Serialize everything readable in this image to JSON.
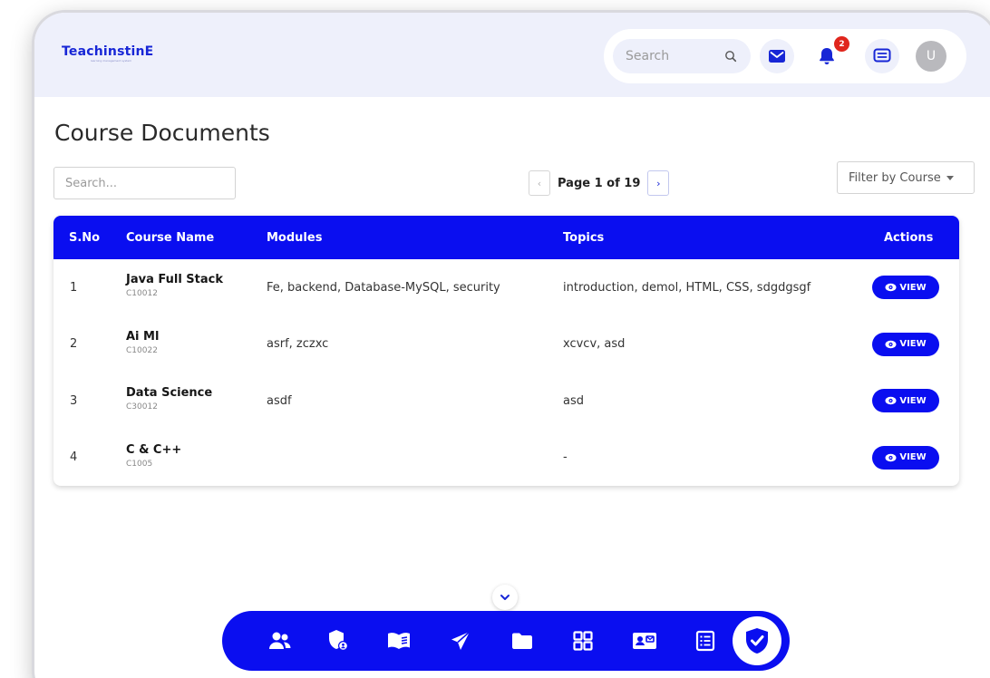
{
  "header": {
    "logo": "TeachinstinE",
    "logo_tagline": "learning management system",
    "search_placeholder": "Search",
    "notification_count": "2",
    "avatar_initial": "U"
  },
  "page": {
    "title": "Course Documents",
    "search_placeholder": "Search...",
    "pagination": {
      "text": "Page 1 of 19",
      "prev": "‹",
      "next": "›"
    },
    "filter_label": "Filter by Course"
  },
  "table": {
    "columns": [
      "S.No",
      "Course Name",
      "Modules",
      "Topics",
      "Actions"
    ],
    "rows": [
      {
        "sno": "1",
        "name": "Java Full Stack",
        "code": "C10012",
        "modules": "Fe, backend, Database-MySQL, security",
        "topics": "introduction, demol, HTML, CSS, sdgdgsgf",
        "action": "VIEW"
      },
      {
        "sno": "2",
        "name": "Ai Ml",
        "code": "C10022",
        "modules": "asrf, zczxc",
        "topics": "xcvcv, asd",
        "action": "VIEW"
      },
      {
        "sno": "3",
        "name": "Data Science",
        "code": "C30012",
        "modules": "asdf",
        "topics": "asd",
        "action": "VIEW"
      },
      {
        "sno": "4",
        "name": "C & C++",
        "code": "C1005",
        "modules": "",
        "topics": "-",
        "action": "VIEW"
      }
    ]
  },
  "dock": {
    "icons": [
      "users-icon",
      "shield-user-icon",
      "book-icon",
      "send-icon",
      "folder-icon",
      "grid-icon",
      "id-card-icon",
      "list-icon",
      "shield-check-icon"
    ],
    "active": "shield-check-icon"
  },
  "colors": {
    "primary": "#0a0ef0",
    "header_bg": "#eef0fb",
    "badge": "#e0261d"
  }
}
